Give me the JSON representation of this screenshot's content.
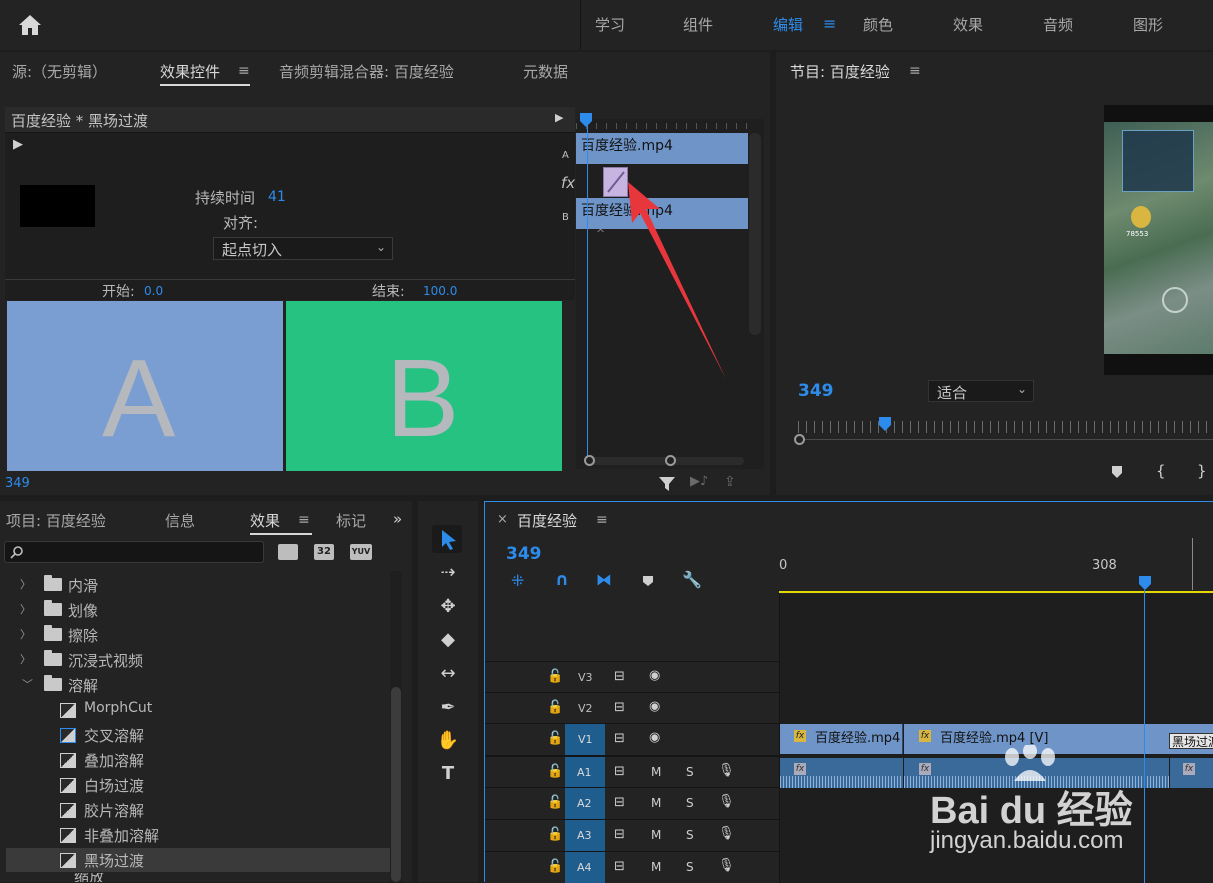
{
  "workspaces": [
    "学习",
    "组件",
    "编辑",
    "颜色",
    "效果",
    "音频",
    "图形"
  ],
  "active_workspace": "编辑",
  "source_panel": {
    "tabs": [
      "源:（无剪辑）",
      "效果控件",
      "音频剪辑混合器: 百度经验",
      "元数据"
    ],
    "active_tab": "效果控件",
    "header": "百度经验 * 黑场过渡",
    "duration_label": "持续时间",
    "duration_value": "41",
    "align_label": "对齐:",
    "align_value": "起点切入",
    "start_label": "开始:",
    "start_value": "0.0",
    "end_label": "结束:",
    "end_value": "100.0",
    "preview_a": "A",
    "preview_b": "B",
    "timecode": "349",
    "track_a_label": "A",
    "track_b_label": "B",
    "fx_label": "fx",
    "clip_a": "百度经验.mp4",
    "clip_b": "百度经验.mp4"
  },
  "program_panel": {
    "title": "节目: 百度经验",
    "timecode": "349",
    "fit_value": "适合",
    "game_number": "78553"
  },
  "project_panel": {
    "tabs": [
      "项目: 百度经验",
      "信息",
      "效果",
      "标记"
    ],
    "active_tab": "效果",
    "search_placeholder": "",
    "badge_32": "32",
    "badge_yuv": "YUV",
    "folders": [
      "内滑",
      "划像",
      "擦除",
      "沉浸式视频",
      "溶解"
    ],
    "dissolve_items": [
      "MorphCut",
      "交叉溶解",
      "叠加溶解",
      "白场过渡",
      "胶片溶解",
      "非叠加溶解",
      "黑场过渡"
    ],
    "selected_item": "黑场过渡",
    "partial_next": "缩放"
  },
  "timeline": {
    "title": "百度经验",
    "timecode": "349",
    "ruler_start": "0",
    "ruler_mark": "308",
    "tracks": [
      {
        "name": "V3",
        "type": "video"
      },
      {
        "name": "V2",
        "type": "video"
      },
      {
        "name": "V1",
        "type": "video"
      },
      {
        "name": "A1",
        "type": "audio"
      },
      {
        "name": "A2",
        "type": "audio"
      },
      {
        "name": "A3",
        "type": "audio"
      },
      {
        "name": "A4",
        "type": "audio"
      }
    ],
    "clip1": "百度经验.mp4",
    "clip2": "百度经验.mp4 [V]",
    "transition_label": "黑场过渡",
    "m_label": "M",
    "s_label": "S"
  },
  "watermark": {
    "brand": "Bai du 经验",
    "url": "jingyan.baidu.com"
  },
  "colors": {
    "accent": "#2d8ceb",
    "clip_blue": "#6f95c8",
    "preview_a": "#7b9ed2",
    "preview_b": "#26c282",
    "playhead": "#2d8ceb",
    "arrow_red": "#e8373c"
  }
}
